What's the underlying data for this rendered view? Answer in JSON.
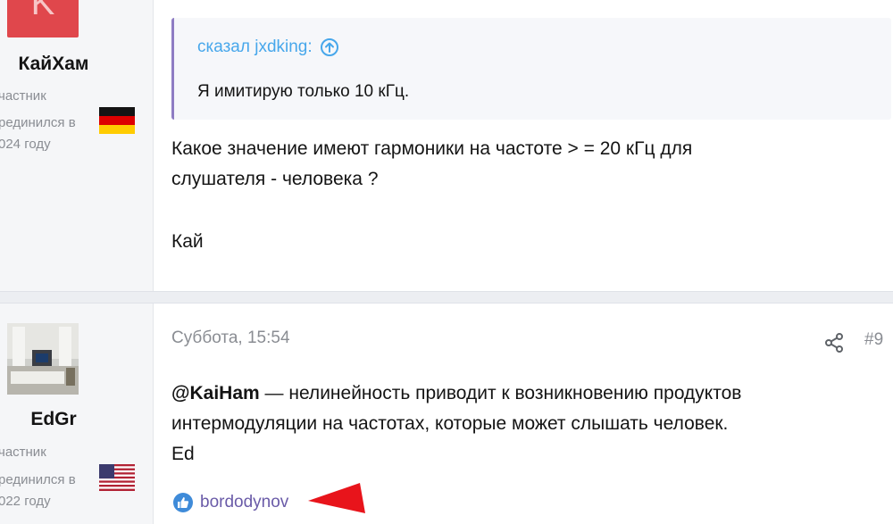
{
  "post1": {
    "avatar_letter": "K",
    "username": "КайХам",
    "user_title": "частник",
    "joined_line1": "рединился в",
    "joined_line2": "024 году",
    "flag": "germany-flag",
    "quote": {
      "header": "сказал jxdking:",
      "text": "Я имитирую только 10 кГц."
    },
    "message_line1": "Какое значение имеют гармоники на частоте > = 20 кГц для",
    "message_line2": "слушателя - человека ?",
    "signature": "Кай"
  },
  "post2": {
    "username": "EdGr",
    "user_title": "частник",
    "joined_line1": "рединился в",
    "joined_line2": "022 году",
    "flag": "usa-flag",
    "date": "Суббота, 15:54",
    "post_number": "#9",
    "mention": "@KaiHam",
    "message_line1_rest": " — нелинейность приводит к возникновению продуктов",
    "message_line2": "интермодуляции на частотах, которые может слышать человек.",
    "message_line3": "Ed",
    "reaction_user": "bordodynov"
  },
  "colors": {
    "quote_link": "#47a7eb",
    "quote_border": "#8e7cc3",
    "reaction_link": "#6a5ba8",
    "like_icon": "#3f8bd9",
    "arrow": "#e8141b",
    "avatar_k": "#e0474c"
  }
}
